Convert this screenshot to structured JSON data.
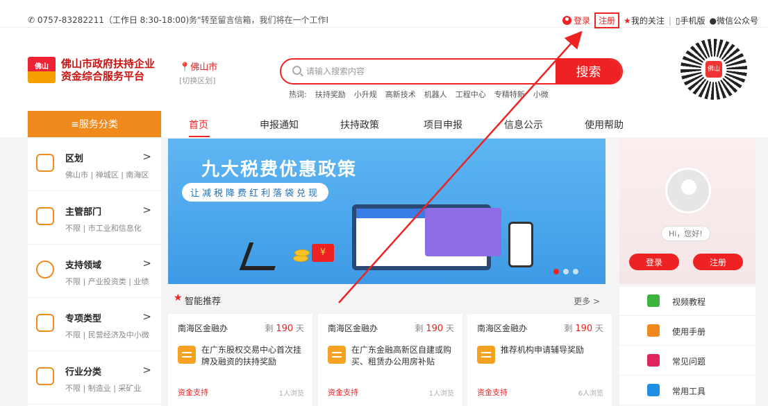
{
  "topbar": {
    "phone": "0757-83282211（工作日 8:30-18:00)",
    "notice": "务\"转至留言信箱，我们将在一个工作E",
    "login": "登录",
    "register": "注册",
    "follow": "我的关注",
    "divider": "|",
    "mobile": "手机版",
    "wechat": "微信公众号"
  },
  "header": {
    "logo_badge": "佛山",
    "logo_line1": "佛山市政府扶持企业",
    "logo_line2": "资金综合服务平台",
    "city": "佛山市",
    "city_switch": "[切换区划]",
    "search_placeholder": "请输入搜索内容",
    "search_button": "搜索",
    "hot_label": "热词:",
    "hot_words": [
      "扶持奖励",
      "小升规",
      "高新技术",
      "机器人",
      "工程中心",
      "专精特新",
      "小微"
    ],
    "qr_center": "佛山"
  },
  "nav": {
    "category": "≡服务分类",
    "items": [
      "首页",
      "申报通知",
      "扶持政策",
      "项目申报",
      "信息公示",
      "使用帮助"
    ]
  },
  "sidebar": {
    "items": [
      {
        "title": "区划",
        "sub": "佛山市 | 禅城区 | 南海区",
        "arrow": ">"
      },
      {
        "title": "主管部门",
        "sub": "不限 | 市工业和信息化",
        "arrow": ">"
      },
      {
        "title": "支持领域",
        "sub": "不限 | 产业投资类 | 业绩",
        "arrow": ">"
      },
      {
        "title": "专项类型",
        "sub": "不限 | 民营经济及中小微",
        "arrow": ">"
      },
      {
        "title": "行业分类",
        "sub": "不限 | 制造业 | 采矿业",
        "arrow": ">"
      }
    ]
  },
  "banner": {
    "title": "九大税费优惠政策",
    "subtitle": "让减税降费红利落袋兑现",
    "red_envelope": "¥",
    "slides_total": 3,
    "active_slide": 1
  },
  "recommend": {
    "title": "智能推荐",
    "more": "更多 >",
    "cards": [
      {
        "org": "南海区金融办",
        "days_prefix": "剩",
        "days": "190",
        "days_unit": "天",
        "text": "在广东股权交易中心首次挂牌及融资的扶持奖励",
        "tag": "资金支持",
        "views": "1人浏览"
      },
      {
        "org": "南海区金融办",
        "days_prefix": "剩",
        "days": "190",
        "days_unit": "天",
        "text": "在广东金融高新区自建或购买、租赁办公用房补贴",
        "tag": "资金支持",
        "views": "1人浏览"
      },
      {
        "org": "南海区金融办",
        "days_prefix": "剩",
        "days": "190",
        "days_unit": "天",
        "text": "推荐机构申请辅导奖励",
        "tag": "资金支持",
        "views": "6人浏览"
      }
    ]
  },
  "profile": {
    "greeting": "Hi，您好!",
    "login": "登录",
    "register": "注册"
  },
  "quick_links": [
    {
      "label": "视频教程",
      "color": "#3db43d",
      "icon": "play-icon"
    },
    {
      "label": "使用手册",
      "color": "#f08a1c",
      "icon": "book-icon"
    },
    {
      "label": "常见问题",
      "color": "#e0245e",
      "icon": "question-icon"
    },
    {
      "label": "常用工具",
      "color": "#1e90e6",
      "icon": "tools-icon"
    }
  ],
  "colors": {
    "accent": "#e22222",
    "orange": "#f08a1c",
    "banner": "#4aa6ee"
  }
}
